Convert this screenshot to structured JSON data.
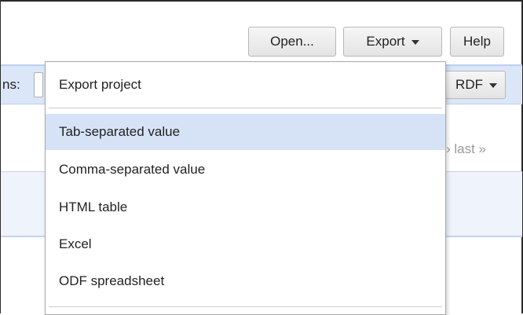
{
  "toolbar": {
    "open_label": "Open...",
    "export_label": "Export",
    "help_label": "Help"
  },
  "band": {
    "label_fragment": "ns:",
    "rdf_label": "RDF"
  },
  "pager": {
    "text": "› last »"
  },
  "export_menu": {
    "heading": "Export project",
    "items": [
      {
        "label": "Tab-separated value",
        "highlighted": true
      },
      {
        "label": "Comma-separated value",
        "highlighted": false
      },
      {
        "label": "HTML table",
        "highlighted": false
      },
      {
        "label": "Excel",
        "highlighted": false
      },
      {
        "label": "ODF spreadsheet",
        "highlighted": false
      }
    ],
    "highlight_color": "#d6e3f7"
  },
  "colors": {
    "band": "#dbe6f8",
    "row": "#eef3fc"
  }
}
